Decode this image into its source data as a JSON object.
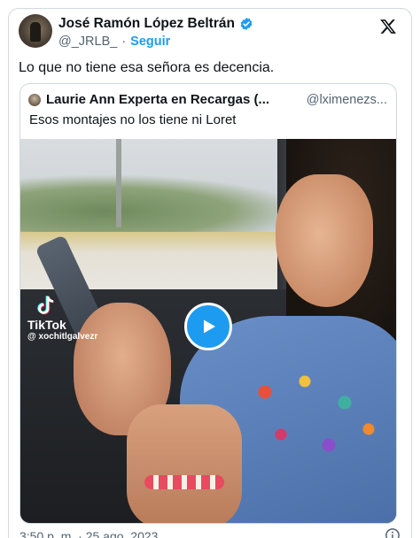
{
  "author": {
    "name": "José Ramón López Beltrán",
    "handle": "@_JRLB_",
    "separator": "·",
    "follow_label": "Seguir",
    "verified_icon": "verified-badge-icon",
    "verified_color": "#1d9bf0"
  },
  "tweet": {
    "text": "Lo que no tiene esa señora es decencia.",
    "timestamp": "3:50 p. m. · 25 ago. 2023"
  },
  "quoted": {
    "name": "Laurie Ann Experta en Recargas (...",
    "handle": "@lximenezs...",
    "text": "Esos montajes no los tiene ni Loret",
    "video": {
      "watermark_brand": "TikTok",
      "watermark_user": "@ xochitlgalvezr",
      "play_icon": "play-icon"
    }
  },
  "colors": {
    "accent": "#1d9bf0",
    "text_primary": "#0f1419",
    "text_secondary": "#536471",
    "border": "#cfd9de"
  }
}
